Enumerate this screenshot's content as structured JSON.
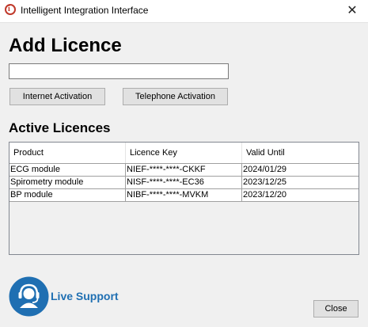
{
  "window": {
    "title": "Intelligent Integration Interface",
    "close_glyph": "✕",
    "app_icon": "app-logo-icon"
  },
  "add_licence": {
    "heading": "Add Licence",
    "input_value": "",
    "internet_button": "Internet Activation",
    "telephone_button": "Telephone Activation"
  },
  "active_licences": {
    "heading": "Active Licences",
    "columns": [
      "Product",
      "Licence Key",
      "Valid Until"
    ],
    "rows": [
      {
        "product": "ECG module",
        "key": "NIEF-****-****-CKKF",
        "valid_until": "2024/01/29"
      },
      {
        "product": "Spirometry module",
        "key": "NISF-****-****-EC36",
        "valid_until": "2023/12/25"
      },
      {
        "product": "BP module",
        "key": "NIBF-****-****-MVKM",
        "valid_until": "2023/12/20"
      }
    ]
  },
  "footer": {
    "support_label": "Live Support",
    "support_icon": "headset-support-icon",
    "close_button": "Close"
  },
  "colors": {
    "support_blue": "#1f6fb2",
    "app_icon_red": "#c0392b"
  }
}
